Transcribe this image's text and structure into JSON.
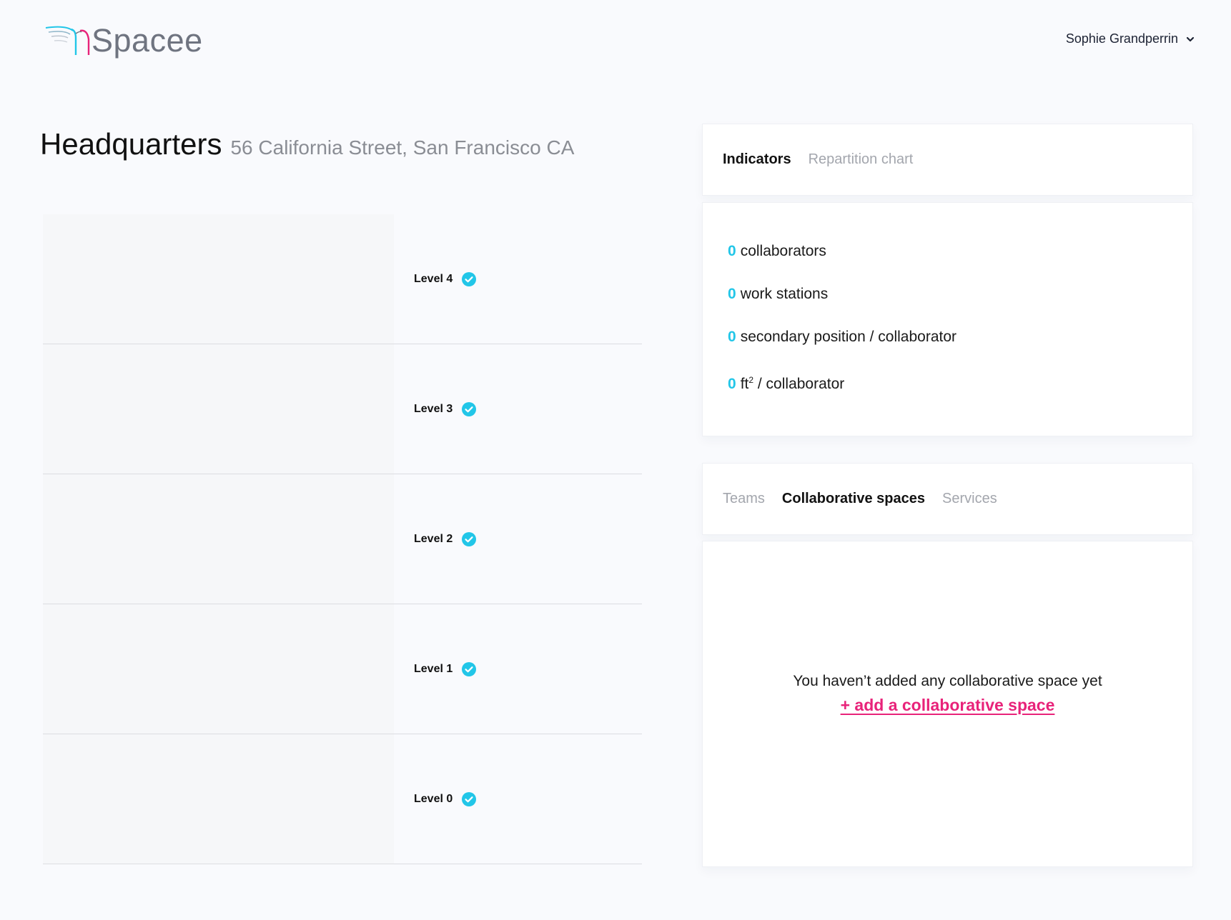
{
  "app": {
    "name": "Spacee",
    "brand_colors": {
      "cyan": "#22c6e8",
      "pink": "#e8237a",
      "grey": "#6f7480"
    },
    "logo_icon": "spacee-logo-icon"
  },
  "header": {
    "user_name": "Sophie Grandperrin",
    "user_menu_icon": "chevron-down-icon"
  },
  "building": {
    "title": "Headquarters",
    "address": "56 California Street, San Francisco CA"
  },
  "levels": [
    {
      "label": "Level 4",
      "status_icon": "check-circle-icon"
    },
    {
      "label": "Level 3",
      "status_icon": "check-circle-icon"
    },
    {
      "label": "Level 2",
      "status_icon": "check-circle-icon"
    },
    {
      "label": "Level 1",
      "status_icon": "check-circle-icon"
    },
    {
      "label": "Level 0",
      "status_icon": "check-circle-icon"
    }
  ],
  "indicators_panel": {
    "tabs": [
      {
        "label": "Indicators",
        "active": true
      },
      {
        "label": "Repartition chart",
        "active": false
      }
    ],
    "items": [
      {
        "value": "0",
        "text": "collaborators"
      },
      {
        "value": "0",
        "text": "work stations"
      },
      {
        "value": "0",
        "text": "secondary position / collaborator"
      },
      {
        "value": "0",
        "unit": "ft",
        "unit_sup": "2",
        "text": "/ collaborator"
      }
    ]
  },
  "spaces_panel": {
    "tabs": [
      {
        "label": "Teams",
        "active": false
      },
      {
        "label": "Collaborative spaces",
        "active": true
      },
      {
        "label": "Services",
        "active": false
      }
    ],
    "empty_message": "You haven’t added any collaborative space yet",
    "add_link": "+ add a collaborative space"
  }
}
